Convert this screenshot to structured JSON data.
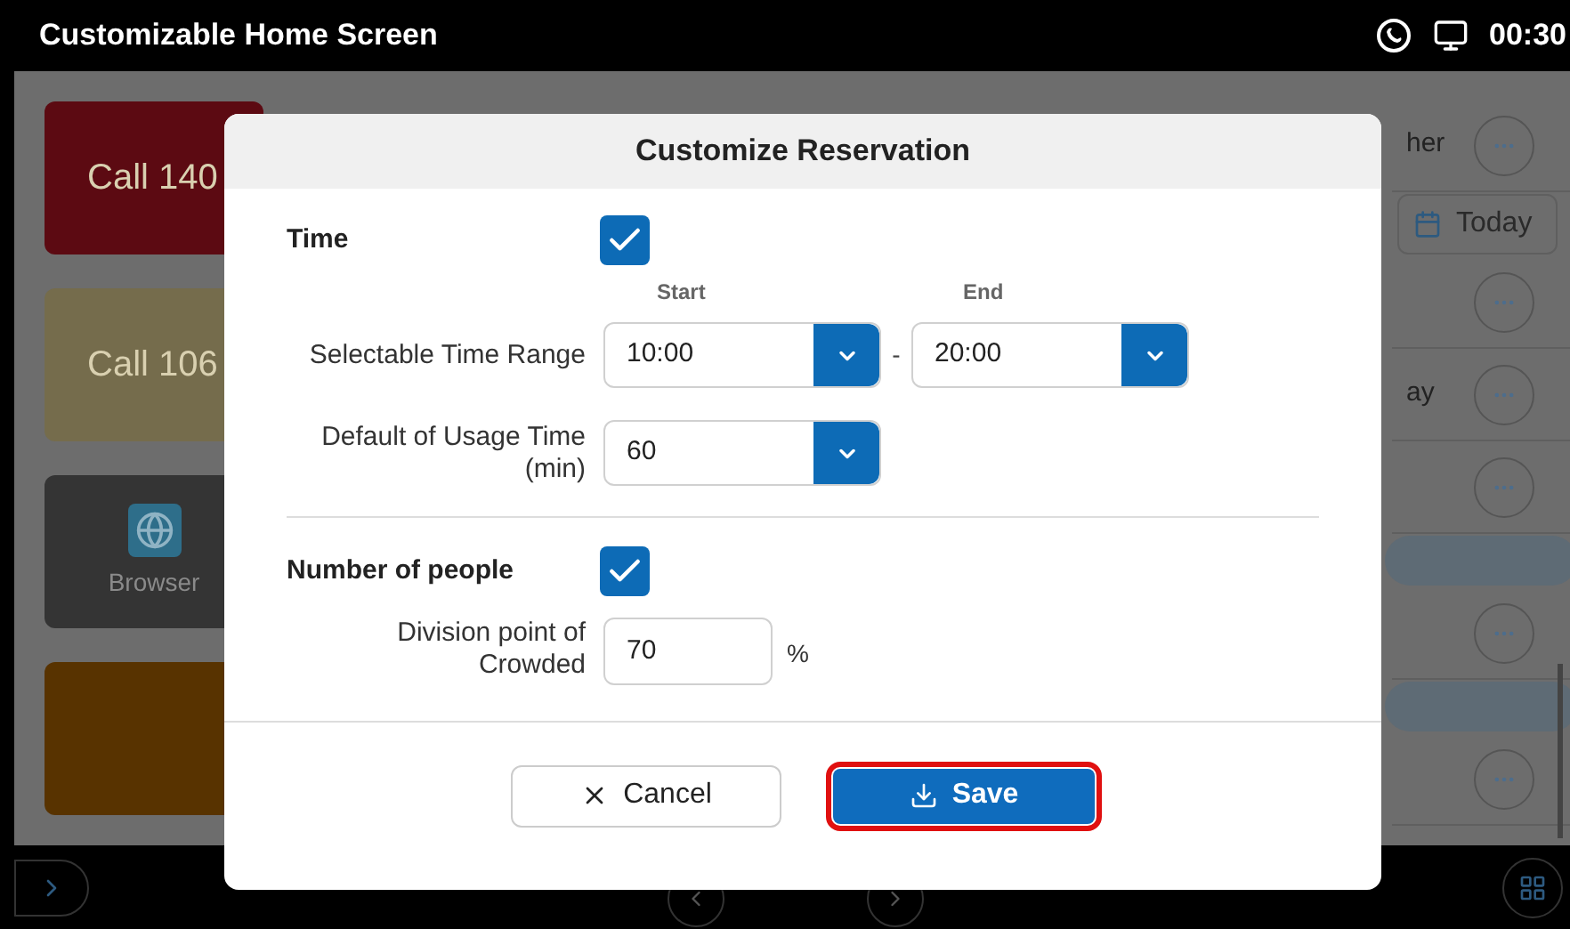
{
  "status_bar": {
    "title": "Customizable Home Screen",
    "time": "00:30"
  },
  "tiles": [
    {
      "kind": "text",
      "label": "Call 140",
      "color": "#5c0a12"
    },
    {
      "kind": "text",
      "label": "Call 106",
      "color": "#756c4c"
    },
    {
      "kind": "app",
      "label": "Browser",
      "color": "#343434"
    },
    {
      "kind": "blank",
      "color": "#583300"
    }
  ],
  "side_list": [
    {
      "kind": "row",
      "label": "her"
    },
    {
      "kind": "date_button",
      "label": "Today"
    },
    {
      "kind": "row"
    },
    {
      "kind": "row",
      "label": "ay"
    },
    {
      "kind": "row"
    },
    {
      "kind": "bar"
    },
    {
      "kind": "row"
    },
    {
      "kind": "bar"
    },
    {
      "kind": "row"
    }
  ],
  "dialog": {
    "title": "Customize Reservation",
    "sections": [
      {
        "label": "Time",
        "checked": true,
        "fields": [
          {
            "kind": "range",
            "label": "Selectable Time Range",
            "start_caption": "Start",
            "end_caption": "End",
            "start": "10:00",
            "separator": "-",
            "end": "20:00"
          },
          {
            "kind": "select",
            "label": "Default of Usage Time (min)",
            "value": "60"
          }
        ]
      },
      {
        "label": "Number of people",
        "checked": true,
        "fields": [
          {
            "kind": "number",
            "label": "Division point of Crowded",
            "value": "70",
            "unit": "%"
          }
        ]
      }
    ],
    "buttons": [
      {
        "kind": "cancel",
        "label": "Cancel",
        "highlighted": false
      },
      {
        "kind": "save",
        "label": "Save",
        "highlighted": true
      }
    ]
  }
}
